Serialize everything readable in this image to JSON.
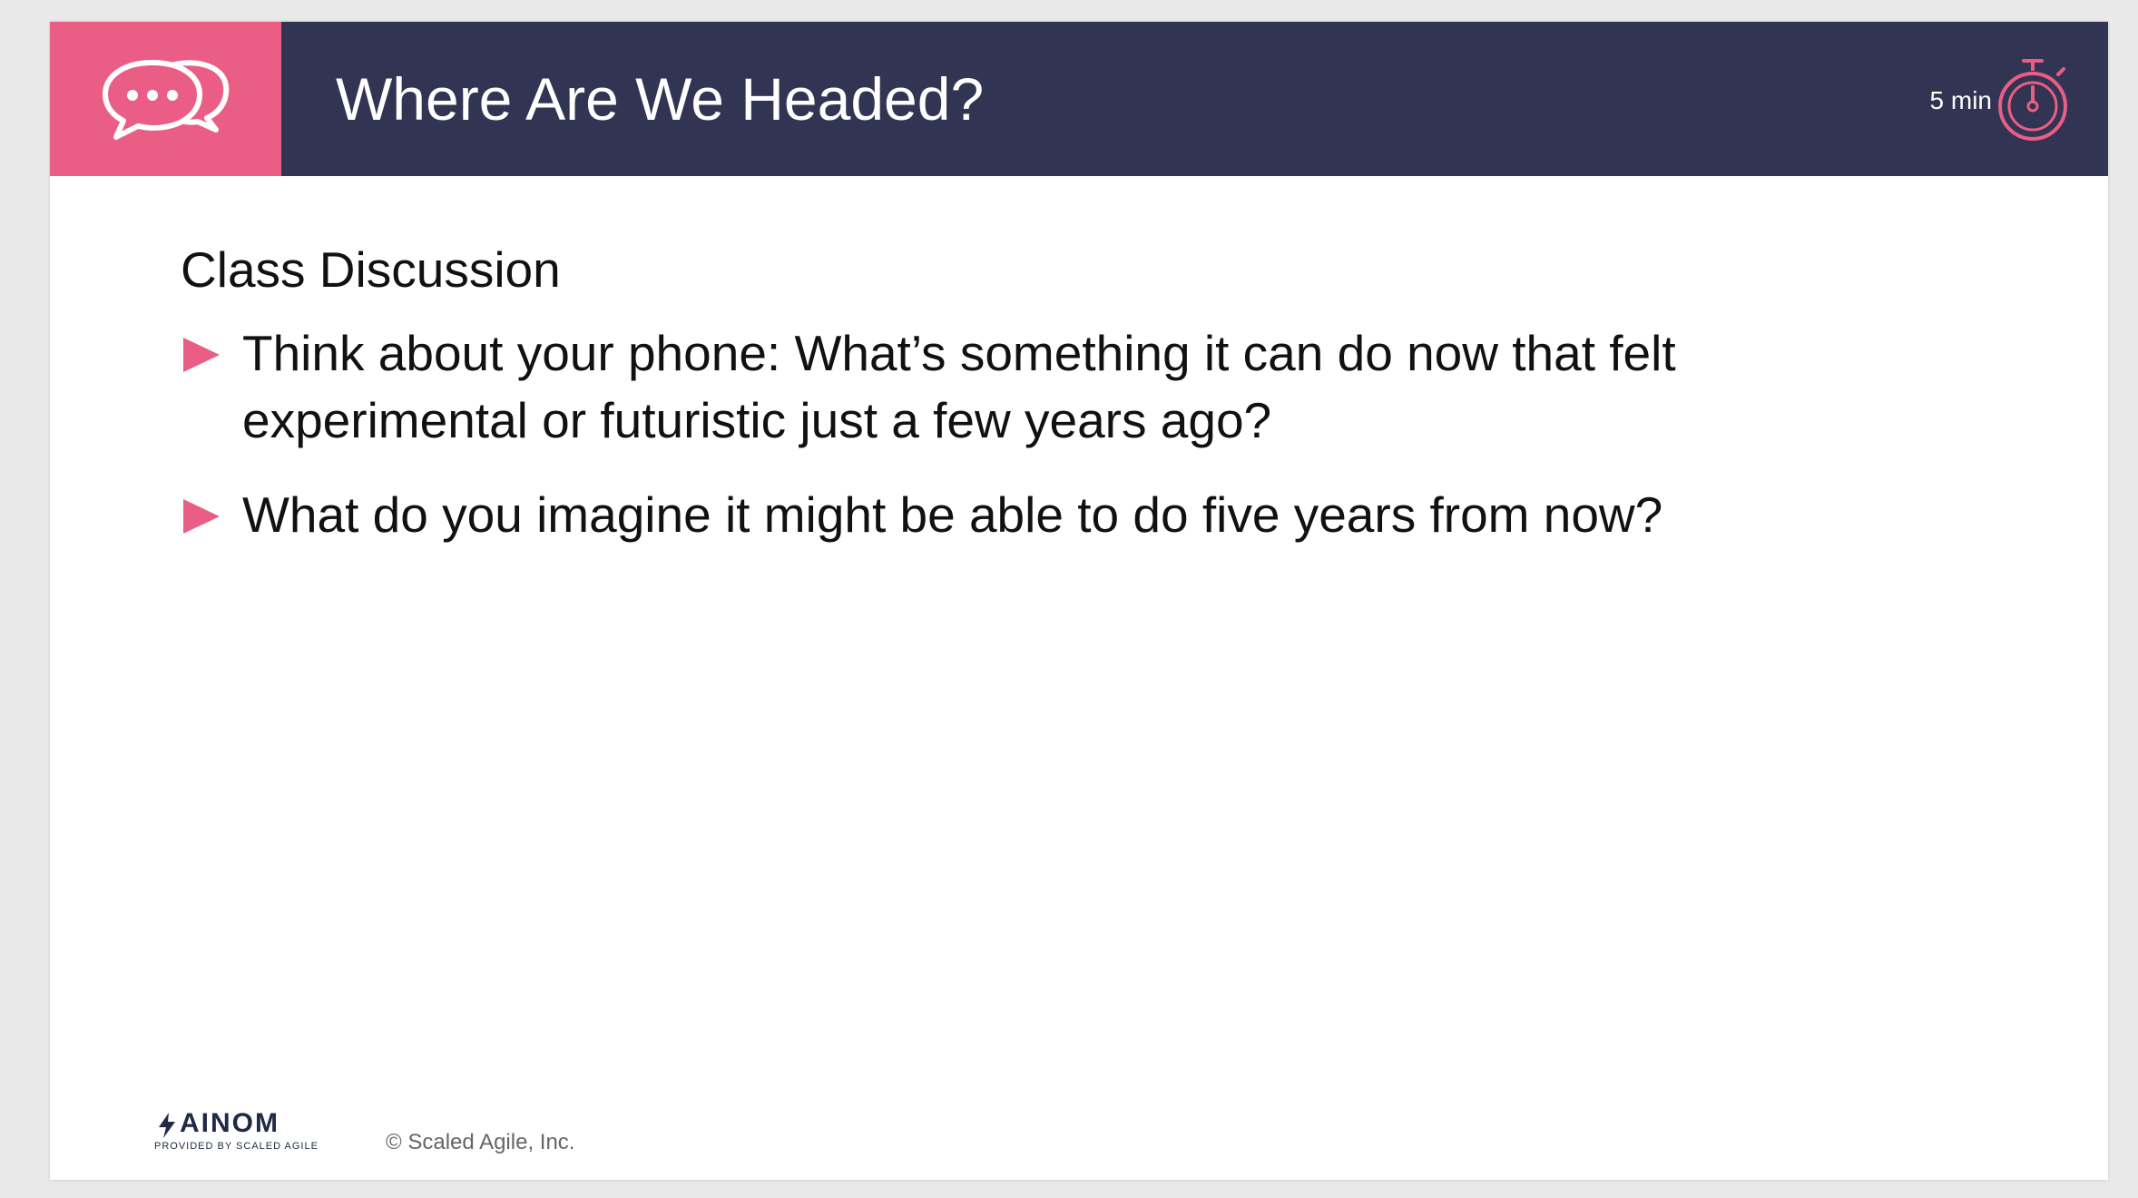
{
  "header": {
    "title": "Where Are We Headed?",
    "duration": "5 min",
    "icon": "discussion-bubbles-icon",
    "timer_icon": "stopwatch-icon",
    "colors": {
      "accent": "#ea5e85",
      "bar": "#323453"
    }
  },
  "content": {
    "subtitle": "Class Discussion",
    "bullets": [
      {
        "lines": [
          "Think about your phone: What’s something it can do now that felt",
          "experimental or futuristic just a few years ago?"
        ]
      },
      {
        "lines": [
          "What do you imagine it might be able to do five years from now?"
        ]
      }
    ]
  },
  "footer": {
    "logo": {
      "name": "AINOM",
      "tagline": "PROVIDED BY SCALED AGILE"
    },
    "copyright": "© Scaled Agile, Inc."
  }
}
